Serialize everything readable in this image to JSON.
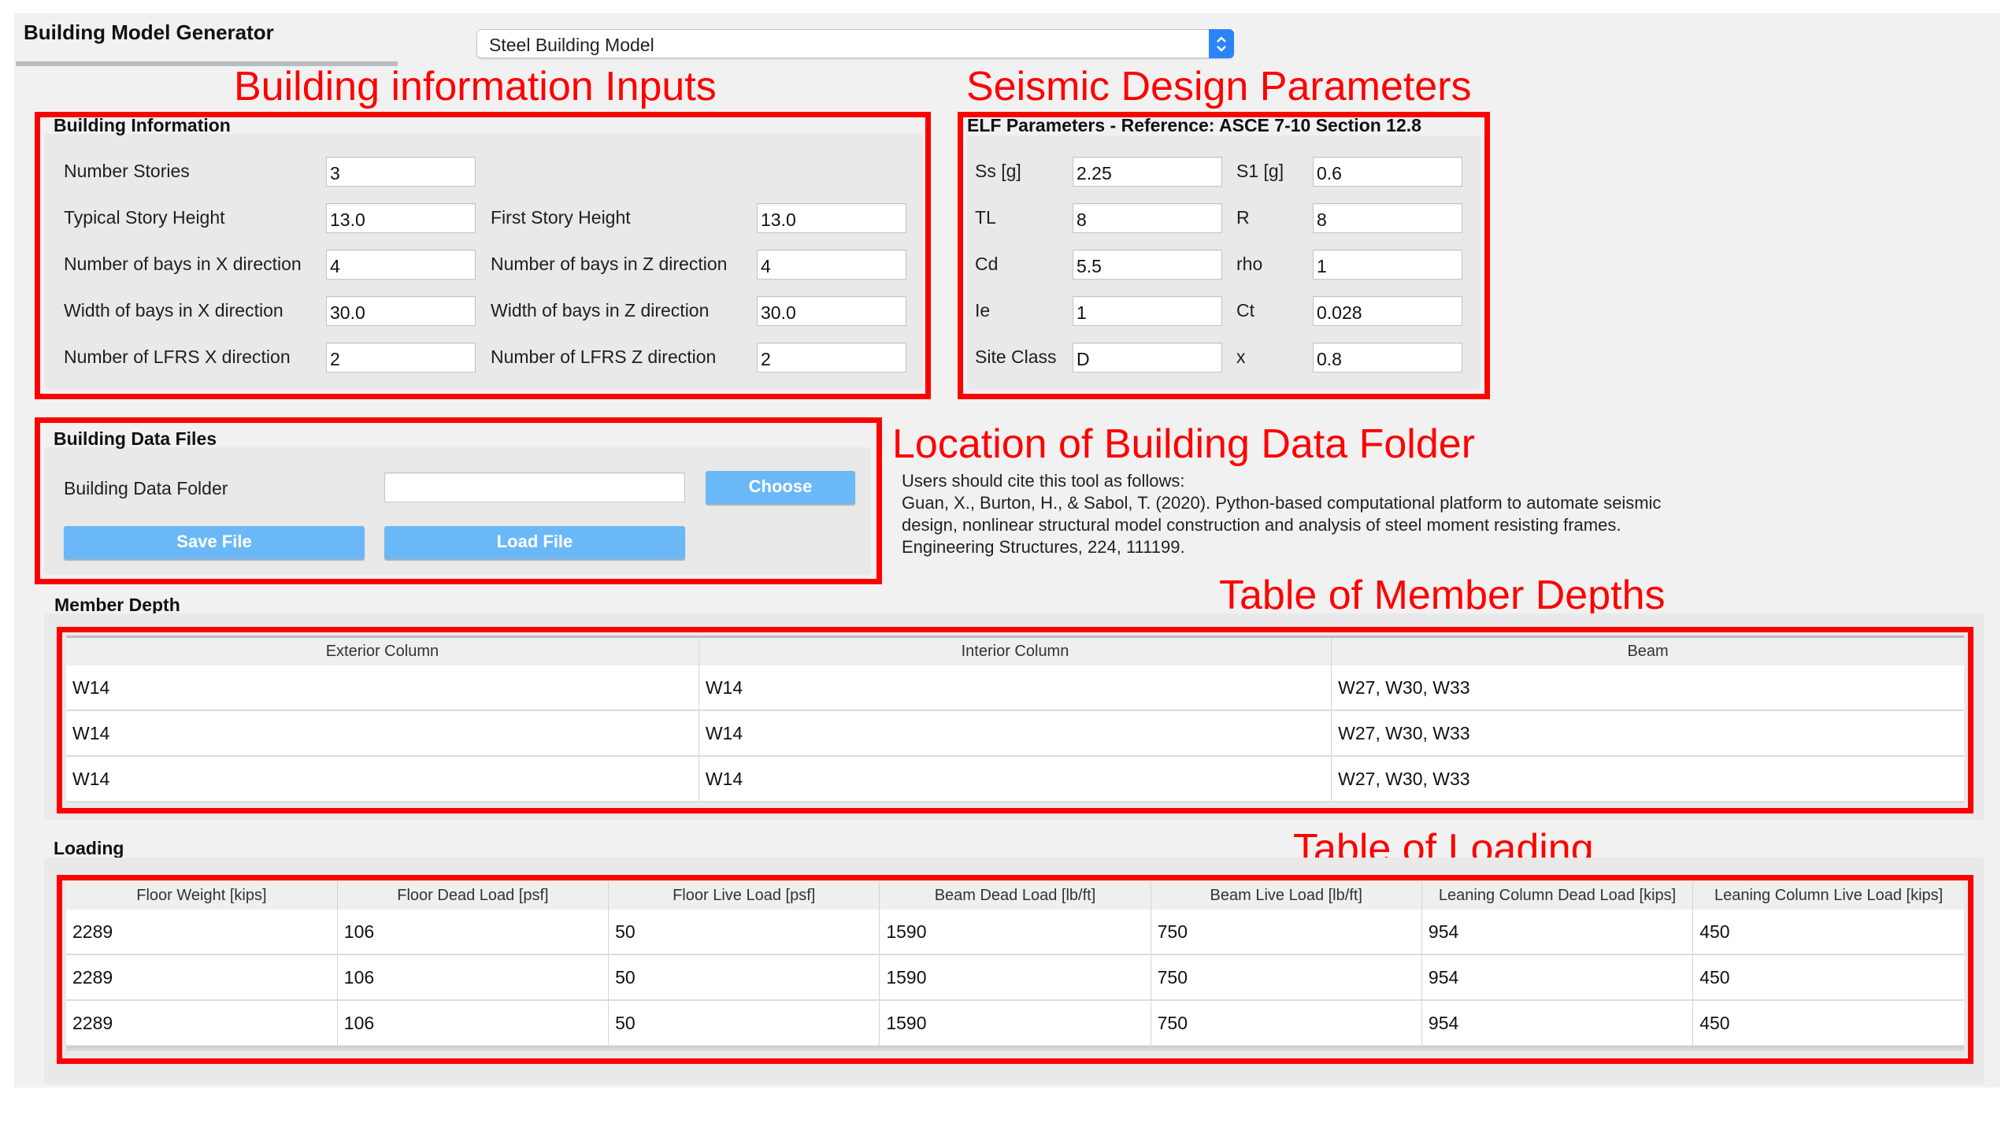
{
  "app": {
    "title": "Building Model Generator",
    "model_select": {
      "selected": "Steel Building Model"
    }
  },
  "annotations": {
    "building_info": "Building information Inputs",
    "seismic": "Seismic Design Parameters",
    "data_folder": "Location of Building Data Folder",
    "member_depths": "Table of Member Depths",
    "loading": "Table of Loading"
  },
  "building_information": {
    "title": "Building Information",
    "fields": [
      {
        "label": "Number Stories",
        "value": "3"
      },
      {
        "label": "Typical Story Height",
        "value": "13.0"
      },
      {
        "label": "First Story Height",
        "value": "13.0"
      },
      {
        "label": "Number of bays in X direction",
        "value": "4"
      },
      {
        "label": "Number of bays in Z direction",
        "value": "4"
      },
      {
        "label": "Width of bays in X direction",
        "value": "30.0"
      },
      {
        "label": "Width of bays in Z direction",
        "value": "30.0"
      },
      {
        "label": "Number of LFRS X direction",
        "value": "2"
      },
      {
        "label": "Number of LFRS Z direction",
        "value": "2"
      }
    ]
  },
  "elf_parameters": {
    "title": "ELF Parameters - Reference: ASCE 7-10 Section 12.8",
    "fields": [
      {
        "label": "Ss [g]",
        "value": "2.25"
      },
      {
        "label": "S1 [g]",
        "value": "0.6"
      },
      {
        "label": "TL",
        "value": "8"
      },
      {
        "label": "R",
        "value": "8"
      },
      {
        "label": "Cd",
        "value": "5.5"
      },
      {
        "label": "rho",
        "value": "1"
      },
      {
        "label": "Ie",
        "value": "1"
      },
      {
        "label": "Ct",
        "value": "0.028"
      },
      {
        "label": "Site Class",
        "value": "D"
      },
      {
        "label": "x",
        "value": "0.8"
      }
    ]
  },
  "data_files": {
    "title": "Building Data Files",
    "folder_label": "Building Data Folder",
    "folder_value": "",
    "choose_label": "Choose",
    "save_label": "Save File",
    "load_label": "Load File"
  },
  "citation": {
    "lines": [
      "Users should cite this tool as follows:",
      "Guan, X., Burton, H., & Sabol, T. (2020). Python-based computational platform to automate seismic",
      "design, nonlinear structural model construction and analysis of steel moment resisting frames.",
      "Engineering Structures, 224, 111199."
    ]
  },
  "member_depth": {
    "title": "Member Depth",
    "columns": [
      "Exterior Column",
      "Interior Column",
      "Beam"
    ],
    "rows": [
      [
        "W14",
        "W14",
        "W27, W30, W33"
      ],
      [
        "W14",
        "W14",
        "W27, W30, W33"
      ],
      [
        "W14",
        "W14",
        "W27, W30, W33"
      ]
    ]
  },
  "loading": {
    "title": "Loading",
    "columns": [
      "Floor Weight [kips]",
      "Floor Dead Load [psf]",
      "Floor Live Load [psf]",
      "Beam Dead Load [lb/ft]",
      "Beam Live Load [lb/ft]",
      "Leaning Column Dead Load [kips]",
      "Leaning Column Live Load [kips]"
    ],
    "rows": [
      [
        "2289",
        "106",
        "50",
        "1590",
        "750",
        "954",
        "450"
      ],
      [
        "2289",
        "106",
        "50",
        "1590",
        "750",
        "954",
        "450"
      ],
      [
        "2289",
        "106",
        "50",
        "1590",
        "750",
        "954",
        "450"
      ]
    ]
  }
}
